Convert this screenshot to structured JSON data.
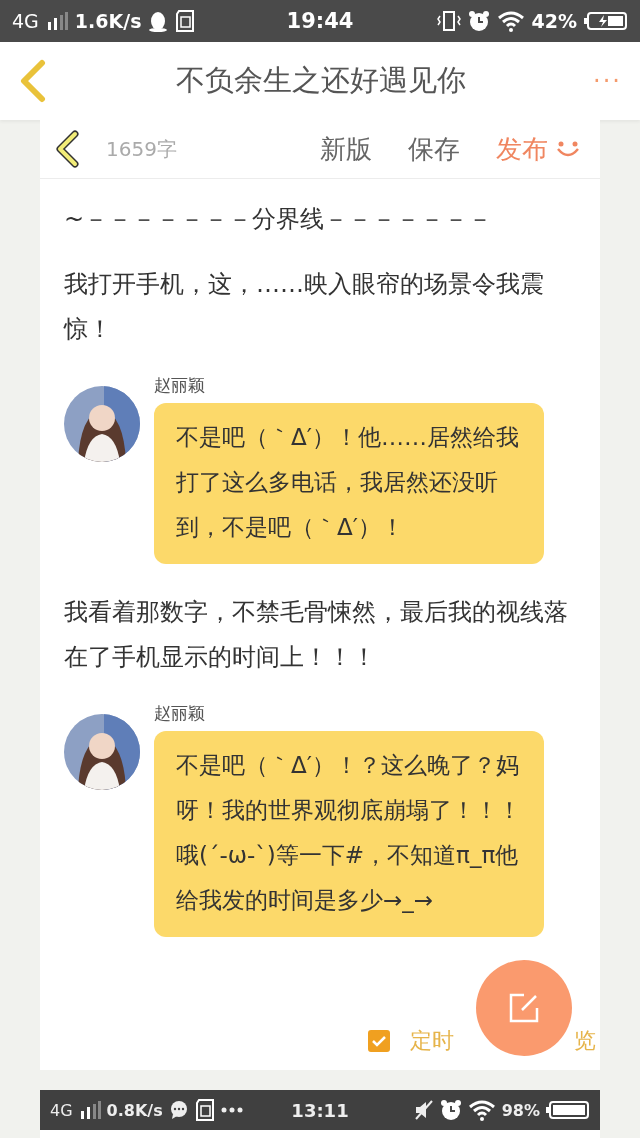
{
  "status_bar": {
    "network": "4G",
    "speed": "1.6K/s",
    "time": "19:44",
    "battery": "42%"
  },
  "header": {
    "title": "不负余生之还好遇见你",
    "more": "···"
  },
  "editor": {
    "word_count": "1659字",
    "actions": [
      {
        "kind": "plain",
        "label": "新版"
      },
      {
        "kind": "plain",
        "label": "保存"
      },
      {
        "kind": "publish",
        "label": "发布"
      }
    ]
  },
  "content": [
    {
      "kind": "paragraph",
      "text": "~－－－－－－－分界线－－－－－－－"
    },
    {
      "kind": "paragraph",
      "text": "我打开手机，这，……映入眼帘的场景令我震惊！"
    },
    {
      "kind": "message",
      "sender": "赵丽颖",
      "text": "不是吧（｀Δ′）！他……居然给我打了这么多电话，我居然还没听到，不是吧（｀Δ′）！"
    },
    {
      "kind": "paragraph",
      "text": "我看着那数字，不禁毛骨悚然，最后我的视线落在了手机显示的时间上！！！"
    },
    {
      "kind": "message",
      "sender": "赵丽颖",
      "text": "不是吧（｀Δ′）！？这么晚了？妈呀！我的世界观彻底崩塌了！！！哦(´-ω-`)等一下#，不知道π_π他给我发的时间是多少→_→"
    }
  ],
  "footer": {
    "timer": {
      "label": "定时",
      "checked": true
    },
    "preview": "览"
  },
  "embedded_status_bar": {
    "network": "4G",
    "speed": "0.8K/s",
    "time": "13:11",
    "battery": "98%"
  }
}
